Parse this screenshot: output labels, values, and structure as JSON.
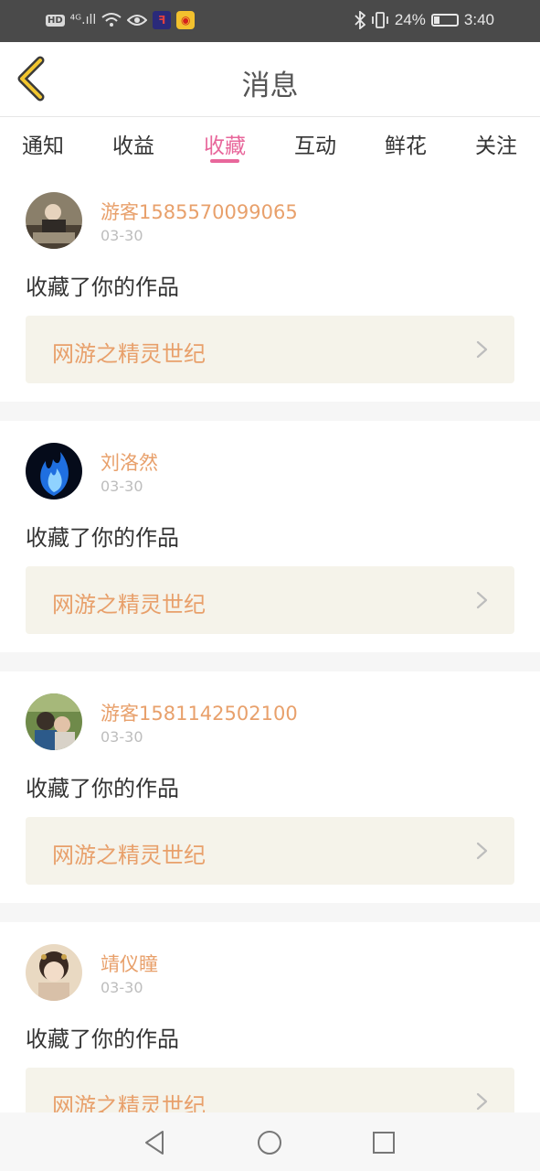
{
  "status_bar": {
    "hd": "HD",
    "signal": "⁴ᴳ.ıll",
    "battery_percent": "24%",
    "battery_level": 0.24,
    "time": "3:40"
  },
  "header": {
    "title": "消息"
  },
  "tabs": [
    {
      "label": "通知",
      "active": false
    },
    {
      "label": "收益",
      "active": false
    },
    {
      "label": "收藏",
      "active": true
    },
    {
      "label": "互动",
      "active": false
    },
    {
      "label": "鲜花",
      "active": false
    },
    {
      "label": "关注",
      "active": false
    }
  ],
  "feed": [
    {
      "user": "游客1585570099065",
      "date": "03-30",
      "action": "收藏了你的作品",
      "work": "网游之精灵世纪"
    },
    {
      "user": "刘洛然",
      "date": "03-30",
      "action": "收藏了你的作品",
      "work": "网游之精灵世纪"
    },
    {
      "user": "游客1581142502100",
      "date": "03-30",
      "action": "收藏了你的作品",
      "work": "网游之精灵世纪"
    },
    {
      "user": "靖仪瞳",
      "date": "03-30",
      "action": "收藏了你的作品",
      "work": "网游之精灵世纪"
    }
  ],
  "colors": {
    "accent": "#e8679b",
    "username": "#e8a06b",
    "card_bg": "#f5f3ea"
  }
}
